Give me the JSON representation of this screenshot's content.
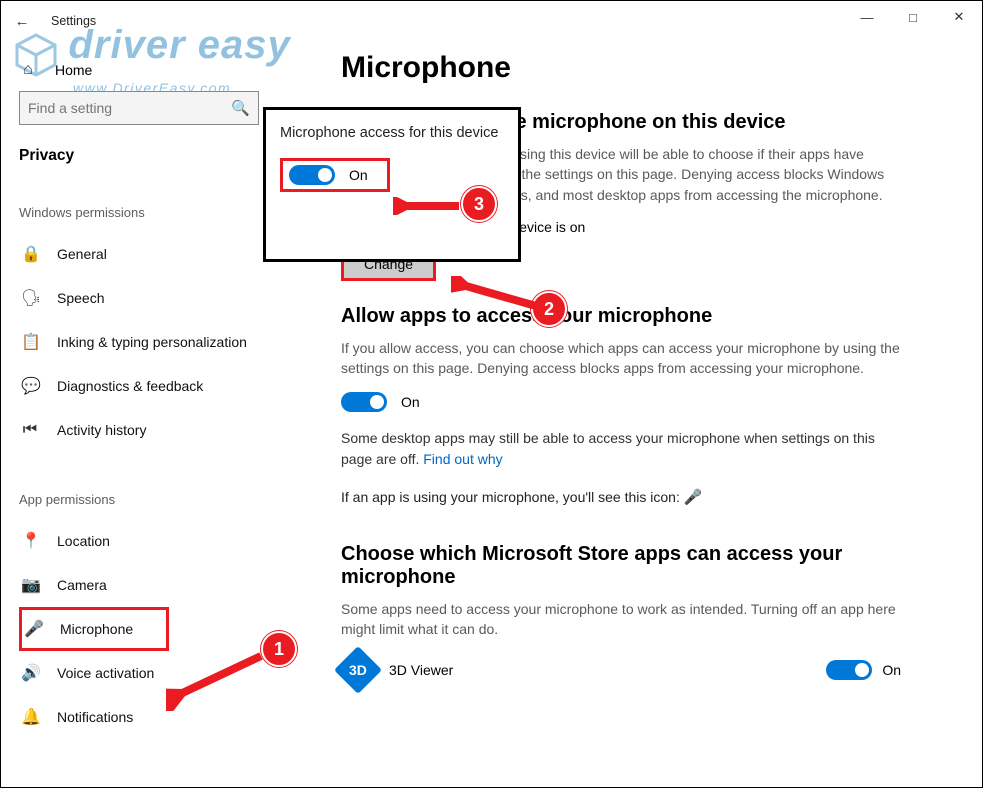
{
  "window": {
    "title": "Settings",
    "home": "Home"
  },
  "search": {
    "placeholder": "Find a setting"
  },
  "privacy_label": "Privacy",
  "section_windows": "Windows permissions",
  "section_apps": "App permissions",
  "nav_windows": [
    {
      "label": "General"
    },
    {
      "label": "Speech"
    },
    {
      "label": "Inking & typing personalization"
    },
    {
      "label": "Diagnostics & feedback"
    },
    {
      "label": "Activity history"
    }
  ],
  "nav_apps": [
    {
      "label": "Location"
    },
    {
      "label": "Camera"
    },
    {
      "label": "Microphone"
    },
    {
      "label": "Voice activation"
    },
    {
      "label": "Notifications"
    }
  ],
  "page": {
    "title": "Microphone",
    "sec1_title": "Allow access to the microphone on this device",
    "sec1_body": "If you allow access, people using this device will be able to choose if their apps have microphone access by using the settings on this page. Denying access blocks Windows features, Microsoft Store apps, and most desktop apps from accessing the microphone.",
    "sec1_status": "Microphone access for this device is on",
    "change_label": "Change",
    "sec2_title": "Allow apps to access your microphone",
    "sec2_body": "If you allow access, you can choose which apps can access your microphone by using the settings on this page. Denying access blocks apps from accessing your microphone.",
    "toggle2_state": "On",
    "sec2_note_a": "Some desktop apps may still be able to access your microphone when settings on this page are off. ",
    "sec2_note_link": "Find out why",
    "sec2_icon_line": "If an app is using your microphone, you'll see this icon:",
    "sec3_title": "Choose which Microsoft Store apps can access your microphone",
    "sec3_body": "Some apps need to access your microphone to work as intended. Turning off an app here might limit what it can do.",
    "app1_name": "3D Viewer",
    "app1_state": "On"
  },
  "popup": {
    "title": "Microphone access for this device",
    "state": "On"
  },
  "badges": {
    "one": "1",
    "two": "2",
    "three": "3"
  },
  "watermark": {
    "l1": "driver easy",
    "l2": "www.DriverEasy.com"
  }
}
